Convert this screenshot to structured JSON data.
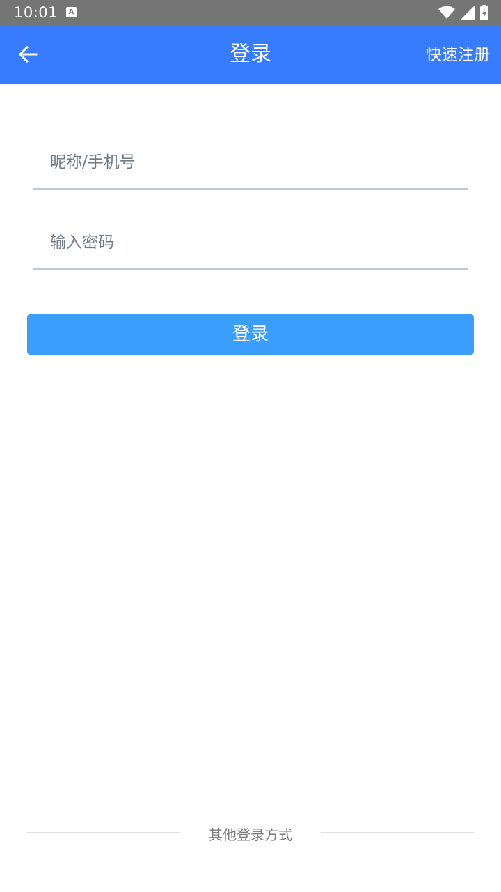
{
  "status_bar": {
    "time": "10:01",
    "notification_icon_letter": "A",
    "icons": [
      "wifi-icon",
      "signal-icon",
      "battery-charging-icon"
    ]
  },
  "app_bar": {
    "title": "登录",
    "back_icon": "arrow-left-icon",
    "register_label": "快速注册",
    "background_color": "#377bfe"
  },
  "form": {
    "nickname_placeholder": "昵称/手机号",
    "nickname_value": "",
    "password_placeholder": "输入密码",
    "password_value": "",
    "login_button_label": "登录",
    "button_color": "#3a9efc"
  },
  "footer": {
    "other_login_label": "其他登录方式"
  }
}
